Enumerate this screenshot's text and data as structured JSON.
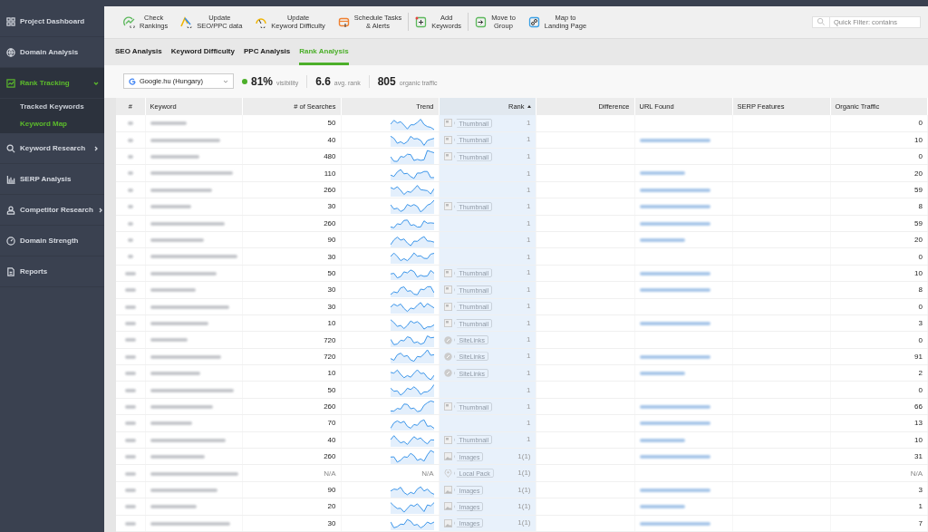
{
  "sidebar": {
    "items": [
      {
        "label": "Project Dashboard",
        "selected": false
      },
      {
        "label": "Domain Analysis",
        "selected": false
      },
      {
        "label": "Rank Tracking",
        "selected": true,
        "expanded": true,
        "children": [
          {
            "label": "Tracked Keywords",
            "selected": false
          },
          {
            "label": "Keyword Map",
            "selected": true
          }
        ]
      },
      {
        "label": "Keyword Research",
        "selected": false,
        "expanded": false
      },
      {
        "label": "SERP Analysis",
        "selected": false
      },
      {
        "label": "Competitor Research",
        "selected": false,
        "expanded": false
      },
      {
        "label": "Domain Strength",
        "selected": false
      },
      {
        "label": "Reports",
        "selected": false
      }
    ]
  },
  "toolbar": {
    "buttons": [
      {
        "label": "Check\nRankings"
      },
      {
        "label": "Update\nSEO/PPC data"
      },
      {
        "label": "Update\nKeyword Difficulty"
      },
      {
        "label": "Schedule Tasks\n& Alerts"
      },
      {
        "label": "Add\nKeywords"
      },
      {
        "label": "Move to\nGroup"
      },
      {
        "label": "Map to\nLanding Page"
      }
    ],
    "quick_filter": {
      "placeholder": "Quick Filter: contains"
    }
  },
  "tabs": [
    {
      "label": "SEO Analysis",
      "selected": false
    },
    {
      "label": "Keyword Difficulty",
      "selected": false
    },
    {
      "label": "PPC Analysis",
      "selected": false
    },
    {
      "label": "Rank Analysis",
      "selected": true
    }
  ],
  "summary": {
    "engine": "Google.hu (Hungary)",
    "visibility": "81%",
    "visibility_label": "visibility",
    "avg_rank": "6.6",
    "avg_rank_label": "avg. rank",
    "traffic": "805",
    "traffic_label": "organic traffic"
  },
  "table": {
    "columns": [
      {
        "label": "#",
        "sorted": false
      },
      {
        "label": "Keyword",
        "sorted": false
      },
      {
        "label": "# of Searches",
        "sorted": false
      },
      {
        "label": "Trend",
        "sorted": false
      },
      {
        "label": "Rank",
        "sorted": true
      },
      {
        "label": "Difference",
        "sorted": false
      },
      {
        "label": "URL Found",
        "sorted": false
      },
      {
        "label": "SERP Features",
        "sorted": false
      },
      {
        "label": "Organic Traffic",
        "sorted": false
      }
    ],
    "rows": [
      {
        "searches": "50",
        "feature": {
          "kind": "thumbnail",
          "label": "Thumbnail"
        },
        "rank": "1",
        "has_url": false,
        "traffic": "0"
      },
      {
        "searches": "40",
        "feature": {
          "kind": "thumbnail",
          "label": "Thumbnail"
        },
        "rank": "1",
        "has_url": true,
        "traffic": "10"
      },
      {
        "searches": "480",
        "feature": {
          "kind": "thumbnail",
          "label": "Thumbnail"
        },
        "rank": "1",
        "has_url": false,
        "traffic": "0"
      },
      {
        "searches": "110",
        "rank": "1",
        "has_url": true,
        "traffic": "20"
      },
      {
        "searches": "260",
        "rank": "1",
        "has_url": true,
        "traffic": "59"
      },
      {
        "searches": "30",
        "feature": {
          "kind": "thumbnail",
          "label": "Thumbnail"
        },
        "rank": "1",
        "has_url": true,
        "traffic": "8"
      },
      {
        "searches": "260",
        "rank": "1",
        "has_url": true,
        "traffic": "59"
      },
      {
        "searches": "90",
        "rank": "1",
        "has_url": true,
        "traffic": "20"
      },
      {
        "searches": "30",
        "rank": "1",
        "has_url": false,
        "traffic": "0"
      },
      {
        "searches": "50",
        "feature": {
          "kind": "thumbnail",
          "label": "Thumbnail"
        },
        "rank": "1",
        "has_url": true,
        "traffic": "10"
      },
      {
        "searches": "30",
        "feature": {
          "kind": "thumbnail",
          "label": "Thumbnail"
        },
        "rank": "1",
        "has_url": true,
        "traffic": "8"
      },
      {
        "searches": "30",
        "feature": {
          "kind": "thumbnail",
          "label": "Thumbnail"
        },
        "rank": "1",
        "has_url": false,
        "traffic": "0"
      },
      {
        "searches": "10",
        "feature": {
          "kind": "thumbnail",
          "label": "Thumbnail"
        },
        "rank": "1",
        "has_url": true,
        "traffic": "3"
      },
      {
        "searches": "720",
        "feature": {
          "kind": "sitelinks",
          "label": "SiteLinks"
        },
        "rank": "1",
        "has_url": false,
        "traffic": "0"
      },
      {
        "searches": "720",
        "feature": {
          "kind": "sitelinks",
          "label": "SiteLinks"
        },
        "rank": "1",
        "has_url": true,
        "traffic": "91"
      },
      {
        "searches": "10",
        "feature": {
          "kind": "sitelinks",
          "label": "SiteLinks"
        },
        "rank": "1",
        "has_url": true,
        "traffic": "2"
      },
      {
        "searches": "50",
        "rank": "1",
        "has_url": false,
        "traffic": "0"
      },
      {
        "searches": "260",
        "feature": {
          "kind": "thumbnail",
          "label": "Thumbnail"
        },
        "rank": "1",
        "has_url": true,
        "traffic": "66"
      },
      {
        "searches": "70",
        "rank": "1",
        "has_url": true,
        "traffic": "13"
      },
      {
        "searches": "40",
        "feature": {
          "kind": "thumbnail",
          "label": "Thumbnail"
        },
        "rank": "1",
        "has_url": true,
        "traffic": "10"
      },
      {
        "searches": "260",
        "feature": {
          "kind": "images",
          "label": "Images"
        },
        "rank": "1(1)",
        "has_url": true,
        "traffic": "31"
      },
      {
        "searches": "N/A",
        "trend": "N/A",
        "feature": {
          "kind": "local",
          "label": "Local Pack"
        },
        "rank": "1(1)",
        "has_url": false,
        "traffic": "N/A"
      },
      {
        "searches": "90",
        "feature": {
          "kind": "images",
          "label": "Images"
        },
        "rank": "1(1)",
        "has_url": true,
        "traffic": "3"
      },
      {
        "searches": "20",
        "feature": {
          "kind": "images",
          "label": "Images"
        },
        "rank": "1(1)",
        "has_url": true,
        "traffic": "1"
      },
      {
        "searches": "30",
        "feature": {
          "kind": "images",
          "label": "Images"
        },
        "rank": "1(1)",
        "has_url": true,
        "traffic": "7"
      }
    ]
  }
}
